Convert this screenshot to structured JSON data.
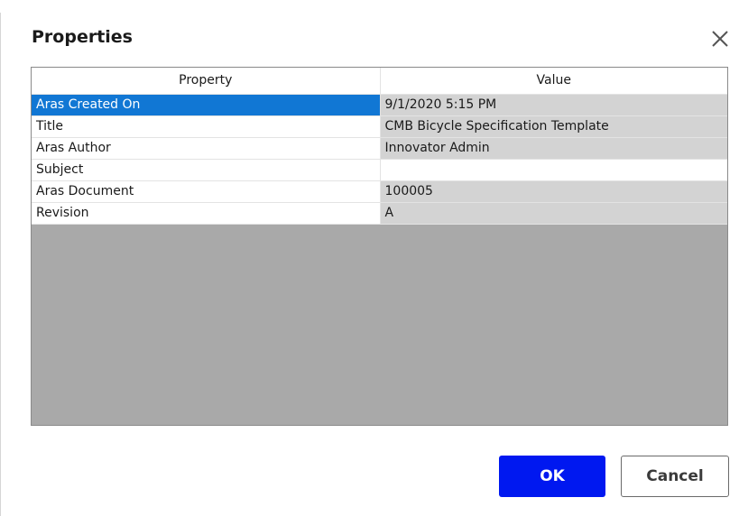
{
  "dialog": {
    "title": "Properties"
  },
  "grid": {
    "columns": [
      "Property",
      "Value"
    ],
    "rows": [
      {
        "property": "Aras Created On",
        "value": "9/1/2020 5:15 PM"
      },
      {
        "property": "Title",
        "value": "CMB Bicycle Specification Template"
      },
      {
        "property": "Aras Author",
        "value": "Innovator Admin"
      },
      {
        "property": "Subject",
        "value": ""
      },
      {
        "property": "Aras Document",
        "value": "100005"
      },
      {
        "property": "Revision",
        "value": "A"
      }
    ],
    "selected_row": "Aras Created On"
  },
  "buttons": {
    "ok_label": "OK",
    "cancel_label": "Cancel"
  },
  "colors": {
    "ok_button": "#0018f0",
    "selection": "#1177d4",
    "readonly_cell": "#d3d3d3",
    "empty_area": "#a9a9a9"
  },
  "icons": {
    "close": "close-icon"
  }
}
